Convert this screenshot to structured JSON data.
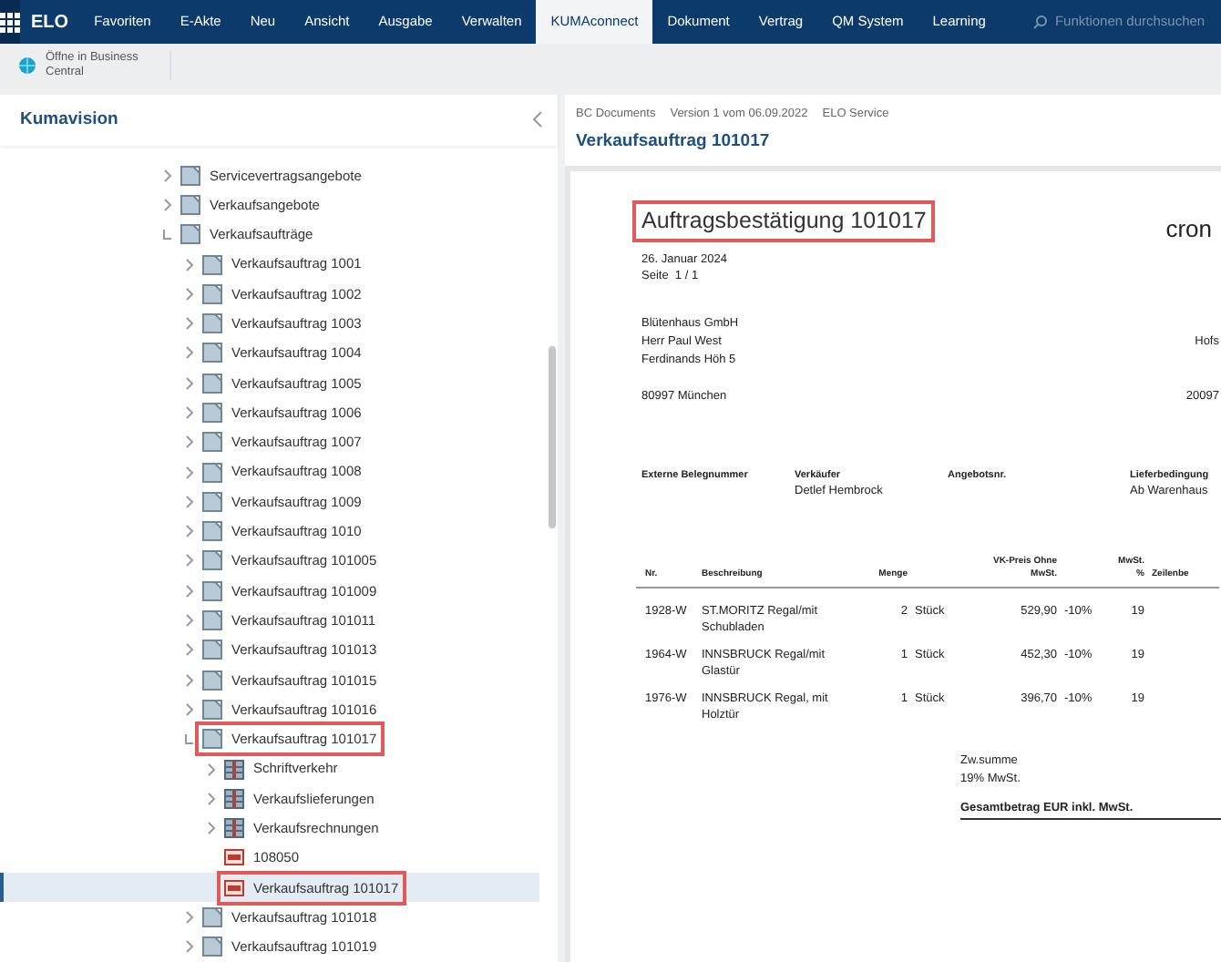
{
  "nav": {
    "brand": "ELO",
    "items": [
      {
        "label": "Favoriten",
        "selected": false
      },
      {
        "label": "E-Akte",
        "selected": false
      },
      {
        "label": "Neu",
        "selected": false
      },
      {
        "label": "Ansicht",
        "selected": false
      },
      {
        "label": "Ausgabe",
        "selected": false
      },
      {
        "label": "Verwalten",
        "selected": false
      },
      {
        "label": "KUMAconnect",
        "selected": true
      },
      {
        "label": "Dokument",
        "selected": false
      },
      {
        "label": "Vertrag",
        "selected": false
      },
      {
        "label": "QM System",
        "selected": false
      },
      {
        "label": "Learning",
        "selected": false
      }
    ],
    "search": {
      "placeholder": "Funktionen durchsuchen"
    }
  },
  "toolbar": {
    "buttons": [
      {
        "label": "Öffne in Business Central"
      }
    ]
  },
  "sidebar": {
    "title": "Kumavision",
    "tree": [
      {
        "label": "Servicevertragsangebote",
        "kind": "folder",
        "expanded": false,
        "selected": false,
        "highlighted": false
      },
      {
        "label": "Verkaufsangebote",
        "kind": "folder",
        "expanded": false,
        "selected": false,
        "highlighted": false
      },
      {
        "label": "Verkaufsaufträge",
        "kind": "folder",
        "expanded": true,
        "selected": false,
        "highlighted": false,
        "children": [
          {
            "label": "Verkaufsauftrag 1001",
            "kind": "folder",
            "expanded": false,
            "selected": false,
            "highlighted": false
          },
          {
            "label": "Verkaufsauftrag 1002",
            "kind": "folder",
            "expanded": false,
            "selected": false,
            "highlighted": false
          },
          {
            "label": "Verkaufsauftrag 1003",
            "kind": "folder",
            "expanded": false,
            "selected": false,
            "highlighted": false
          },
          {
            "label": "Verkaufsauftrag 1004",
            "kind": "folder",
            "expanded": false,
            "selected": false,
            "highlighted": false
          },
          {
            "label": "Verkaufsauftrag 1005",
            "kind": "folder",
            "expanded": false,
            "selected": false,
            "highlighted": false
          },
          {
            "label": "Verkaufsauftrag 1006",
            "kind": "folder",
            "expanded": false,
            "selected": false,
            "highlighted": false
          },
          {
            "label": "Verkaufsauftrag 1007",
            "kind": "folder",
            "expanded": false,
            "selected": false,
            "highlighted": false
          },
          {
            "label": "Verkaufsauftrag 1008",
            "kind": "folder",
            "expanded": false,
            "selected": false,
            "highlighted": false
          },
          {
            "label": "Verkaufsauftrag 1009",
            "kind": "folder",
            "expanded": false,
            "selected": false,
            "highlighted": false
          },
          {
            "label": "Verkaufsauftrag 1010",
            "kind": "folder",
            "expanded": false,
            "selected": false,
            "highlighted": false
          },
          {
            "label": "Verkaufsauftrag 101005",
            "kind": "folder",
            "expanded": false,
            "selected": false,
            "highlighted": false
          },
          {
            "label": "Verkaufsauftrag 101009",
            "kind": "folder",
            "expanded": false,
            "selected": false,
            "highlighted": false
          },
          {
            "label": "Verkaufsauftrag 101011",
            "kind": "folder",
            "expanded": false,
            "selected": false,
            "highlighted": false
          },
          {
            "label": "Verkaufsauftrag 101013",
            "kind": "folder",
            "expanded": false,
            "selected": false,
            "highlighted": false
          },
          {
            "label": "Verkaufsauftrag 101015",
            "kind": "folder",
            "expanded": false,
            "selected": false,
            "highlighted": false
          },
          {
            "label": "Verkaufsauftrag 101016",
            "kind": "folder",
            "expanded": false,
            "selected": false,
            "highlighted": false
          },
          {
            "label": "Verkaufsauftrag 101017",
            "kind": "folder",
            "expanded": true,
            "selected": false,
            "highlighted": true,
            "children": [
              {
                "label": "Schriftverkehr",
                "kind": "register",
                "expanded": false,
                "selected": false,
                "highlighted": false
              },
              {
                "label": "Verkaufslieferungen",
                "kind": "register",
                "expanded": false,
                "selected": false,
                "highlighted": false
              },
              {
                "label": "Verkaufsrechnungen",
                "kind": "register",
                "expanded": false,
                "selected": false,
                "highlighted": false
              },
              {
                "label": "108050",
                "kind": "pdf",
                "selected": false,
                "highlighted": false
              },
              {
                "label": "Verkaufsauftrag 101017",
                "kind": "pdf",
                "selected": true,
                "highlighted": true
              }
            ]
          },
          {
            "label": "Verkaufsauftrag 101018",
            "kind": "folder",
            "expanded": false,
            "selected": false,
            "highlighted": false
          },
          {
            "label": "Verkaufsauftrag 101019",
            "kind": "folder",
            "expanded": false,
            "selected": false,
            "highlighted": false
          }
        ]
      }
    ]
  },
  "viewer": {
    "meta": [
      "BC Documents",
      "Version 1 vom 06.09.2022",
      "ELO Service"
    ],
    "title": "Verkaufsauftrag 101017",
    "document": {
      "heading": "Auftragsbestätigung 101017",
      "heading_highlighted": true,
      "logo": "cron",
      "date": "26. Januar 2024",
      "page": "Seite  1 / 1",
      "address": [
        "Blütenhaus GmbH",
        "Herr Paul West",
        "Ferdinands Höh 5",
        "80997 München"
      ],
      "sender_address": [
        "Hofs",
        "20097"
      ],
      "fields": [
        {
          "label": "Externe Belegnummer"
        },
        {
          "label": "Verkäufer",
          "value": "Detlef Hembrock"
        },
        {
          "label": "Angebotsnr."
        },
        {
          "label": "Lieferbedingung",
          "value": "Ab Warenhaus"
        }
      ],
      "columns": [
        "Nr.",
        "Beschreibung",
        "Menge",
        "",
        "VK-Preis Ohne MwSt.",
        "",
        "MwSt. %",
        "Zeilenbe"
      ],
      "rows": [
        [
          "1928-W",
          "ST.MORITZ Regal/mit Schubladen",
          "2",
          "Stück",
          "529,90",
          "-10%",
          "19"
        ],
        [
          "1964-W",
          "INNSBRUCK Regal/mit Glastür",
          "1",
          "Stück",
          "452,30",
          "-10%",
          "19"
        ],
        [
          "1976-W",
          "INNSBRUCK Regal, mit Holztür",
          "1",
          "Stück",
          "396,70",
          "-10%",
          "19"
        ]
      ],
      "totals": [
        "Zw.summe",
        "19% MwSt."
      ],
      "grand_total": "Gesamtbetrag EUR inkl. MwSt."
    }
  }
}
